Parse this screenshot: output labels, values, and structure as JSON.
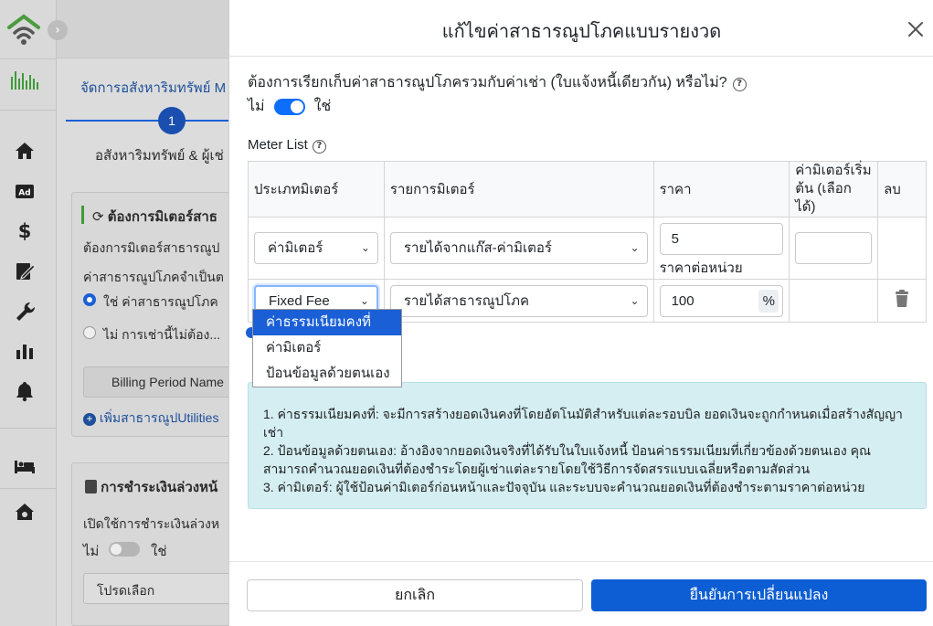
{
  "background": {
    "wizard_title": "จัดการอสังหาริมทรัพย์ M",
    "step_number": "1",
    "step_label": "อสังหาริมทรัพย์ & ผู้เช่",
    "meter_card_title": "ต้องการมิเตอร์สาธ",
    "meter_question": "ต้องการมิเตอร์สาธารณูป",
    "utility_required": "ค่าสาธารณูปโภคจำเป็นต",
    "radio_yes": "ใช่ ค่าสาธารณูปโภค",
    "radio_no": "ไม่ การเช่านี้ไม่ต้อง...",
    "billing_period_button": "Billing Period Name",
    "add_utility_link": "เพิ่มสาธารณูปUtilities",
    "payment_card_title": "การชำระเงินล่วงหน้",
    "enable_prepay": "เปิดใช้การชำระเงินล่วงห",
    "prepay_no": "ไม่",
    "prepay_yes": "ใช่",
    "select_placeholder": "โปรดเลือก",
    "ad_icon_text": "Ad"
  },
  "modal": {
    "title": "แก้ไขค่าสาธารณูปโภคแบบรายงวด",
    "question": "ต้องการเรียกเก็บค่าสาธารณูปโภครวมกับค่าเช่า (ใบแจ้งหนี้เดียวกัน) หรือไม่?",
    "toggle_no": "ไม่",
    "toggle_yes": "ใช่",
    "toggle_on": true,
    "meter_list_label": "Meter List",
    "help_glyph": "?",
    "table": {
      "headers": [
        "ประเภทมิเตอร์",
        "รายการมิเตอร์",
        "ราคา",
        "ค่ามิเตอร์เริ่มต้น (เลือกได้)",
        "ลบ"
      ],
      "rows": [
        {
          "type": "ค่ามิเตอร์",
          "item": "รายได้จากแก๊ส-ค่ามิเตอร์",
          "price": "5",
          "price_note": "ราคาต่อหน่วย",
          "start_value": ""
        },
        {
          "type": "Fixed Fee",
          "item": "รายได้สาธารณูปโภค",
          "price": "100",
          "unit": "%"
        }
      ]
    },
    "dropdown_options": [
      "ค่าธรรมเนียมคงที่",
      "ค่ามิเตอร์",
      "ป้อนข้อมูลด้วยตนเอง"
    ],
    "info_lines": [
      "1. ค่าธรรมเนียมคงที่: จะมีการสร้างยอดเงินคงที่โดยอัตโนมัติสำหรับแต่ละรอบบิล ยอดเงินจะถูกกำหนดเมื่อสร้างสัญญาเช่า",
      "2. ป้อนข้อมูลด้วยตนเอง: อ้างอิงจากยอดเงินจริงที่ได้รับในใบแจ้งหนี้ ป้อนค่าธรรมเนียมที่เกี่ยวข้องด้วยตนเอง คุณสามารถคำนวณยอดเงินที่ต้องชำระโดยผู้เช่าแต่ละรายโดยใช้วิธีการจัดสรรแบบเฉลี่ยหรือตามสัดส่วน",
      "3. ค่ามิเตอร์: ผู้ใช้ป้อนค่ามิเตอร์ก่อนหน้าและปัจจุบัน และระบบจะคำนวณยอดเงินที่ต้องชำระตามราคาต่อหน่วย"
    ],
    "cancel_label": "ยกเลิก",
    "confirm_label": "ยืนยันการเปลี่ยนแปลง"
  },
  "colors": {
    "primary": "#0d5ed4",
    "info_bg": "#d4eef2",
    "logo_green": "#3f9a3a"
  }
}
